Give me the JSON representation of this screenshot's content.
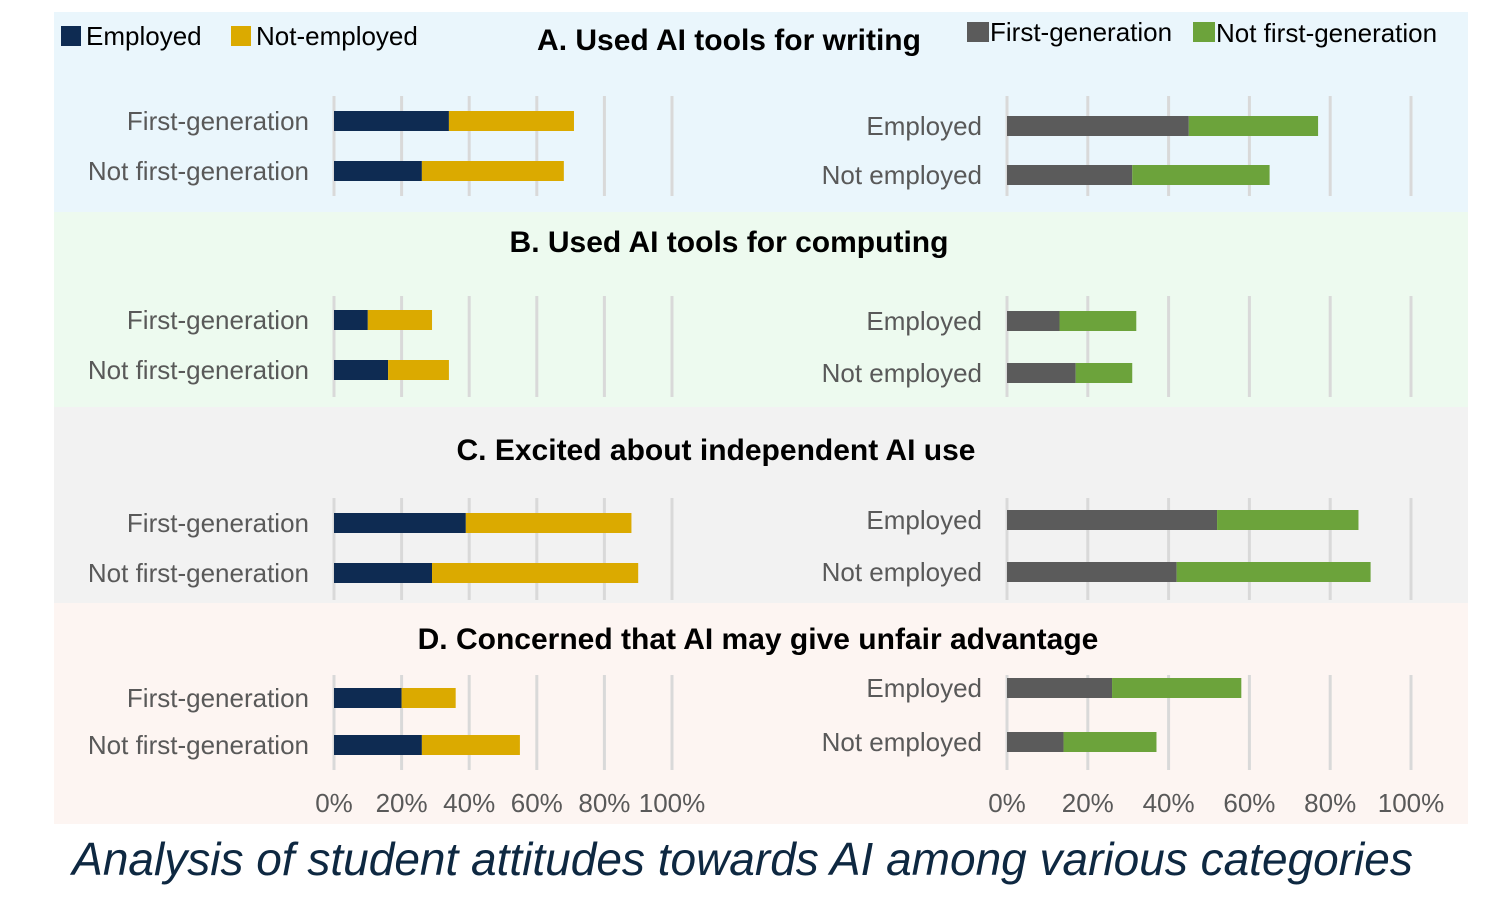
{
  "caption": "Analysis of student attitudes towards AI among various categories",
  "colors": {
    "employed": "#0e2b52",
    "not_employed": "#dbaa00",
    "first_generation": "#5b5b5b",
    "not_first_generation": "#6ca33b",
    "gridline": "#d9d9d9",
    "panel_backgrounds": [
      "#eaf6fc",
      "#edfaef",
      "#f2f2f2",
      "#fdf5f2"
    ]
  },
  "chart_data": {
    "type": "bar",
    "orientation": "horizontal",
    "stacked": true,
    "units": "percent",
    "left_chart": {
      "legend": [
        "Employed",
        "Not-employed"
      ],
      "legend_position": "top-left",
      "categories": [
        "First-generation",
        "Not first-generation"
      ],
      "xlim": [
        0,
        100
      ],
      "xticks": [
        "0%",
        "20%",
        "40%",
        "60%",
        "80%",
        "100%"
      ],
      "grid": true
    },
    "right_chart": {
      "legend": [
        "First-generation",
        "Not first-generation"
      ],
      "legend_position": "top-right",
      "categories": [
        "Employed",
        "Not employed"
      ],
      "xlim": [
        0,
        100
      ],
      "xticks": [
        "0%",
        "20%",
        "40%",
        "60%",
        "80%",
        "100%"
      ],
      "grid": true
    },
    "panels": [
      {
        "title": "A. Used AI tools for writing",
        "left": {
          "series": [
            {
              "name": "Employed",
              "values": [
                34,
                26
              ]
            },
            {
              "name": "Not-employed",
              "values": [
                37,
                42
              ]
            }
          ]
        },
        "right": {
          "series": [
            {
              "name": "First-generation",
              "values": [
                45,
                31
              ]
            },
            {
              "name": "Not first-generation",
              "values": [
                32,
                34
              ]
            }
          ]
        }
      },
      {
        "title": "B. Used AI tools for computing",
        "left": {
          "series": [
            {
              "name": "Employed",
              "values": [
                10,
                16
              ]
            },
            {
              "name": "Not-employed",
              "values": [
                19,
                18
              ]
            }
          ]
        },
        "right": {
          "series": [
            {
              "name": "First-generation",
              "values": [
                13,
                17
              ]
            },
            {
              "name": "Not first-generation",
              "values": [
                19,
                14
              ]
            }
          ]
        }
      },
      {
        "title": "C. Excited about independent AI use",
        "left": {
          "series": [
            {
              "name": "Employed",
              "values": [
                39,
                29
              ]
            },
            {
              "name": "Not-employed",
              "values": [
                49,
                61
              ]
            }
          ]
        },
        "right": {
          "series": [
            {
              "name": "First-generation",
              "values": [
                52,
                42
              ]
            },
            {
              "name": "Not first-generation",
              "values": [
                35,
                48
              ]
            }
          ]
        }
      },
      {
        "title": "D. Concerned that AI may give unfair advantage",
        "left": {
          "series": [
            {
              "name": "Employed",
              "values": [
                20,
                26
              ]
            },
            {
              "name": "Not-employed",
              "values": [
                16,
                29
              ]
            }
          ]
        },
        "right": {
          "series": [
            {
              "name": "First-generation",
              "values": [
                26,
                14
              ]
            },
            {
              "name": "Not first-generation",
              "values": [
                32,
                23
              ]
            }
          ]
        }
      }
    ]
  }
}
